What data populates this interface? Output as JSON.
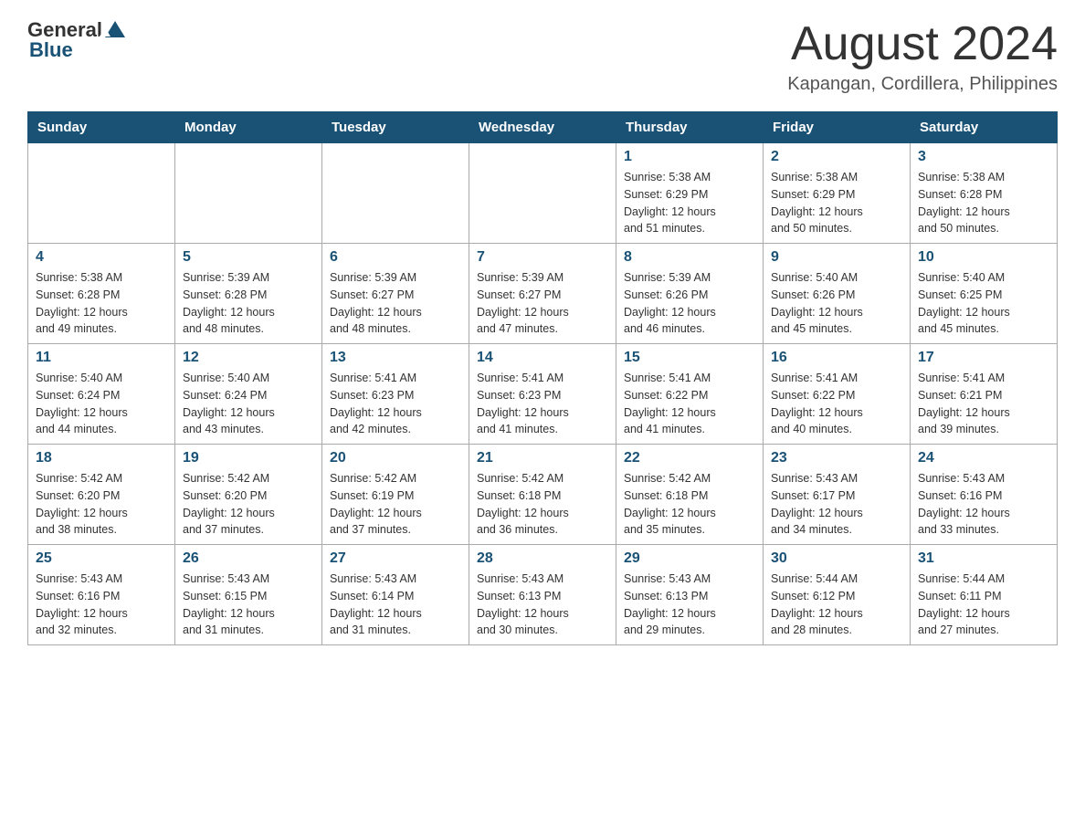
{
  "header": {
    "logo_general": "General",
    "logo_blue": "Blue",
    "title": "August 2024",
    "location": "Kapangan, Cordillera, Philippines"
  },
  "calendar": {
    "days_of_week": [
      "Sunday",
      "Monday",
      "Tuesday",
      "Wednesday",
      "Thursday",
      "Friday",
      "Saturday"
    ],
    "weeks": [
      [
        {
          "day": "",
          "info": ""
        },
        {
          "day": "",
          "info": ""
        },
        {
          "day": "",
          "info": ""
        },
        {
          "day": "",
          "info": ""
        },
        {
          "day": "1",
          "info": "Sunrise: 5:38 AM\nSunset: 6:29 PM\nDaylight: 12 hours\nand 51 minutes."
        },
        {
          "day": "2",
          "info": "Sunrise: 5:38 AM\nSunset: 6:29 PM\nDaylight: 12 hours\nand 50 minutes."
        },
        {
          "day": "3",
          "info": "Sunrise: 5:38 AM\nSunset: 6:28 PM\nDaylight: 12 hours\nand 50 minutes."
        }
      ],
      [
        {
          "day": "4",
          "info": "Sunrise: 5:38 AM\nSunset: 6:28 PM\nDaylight: 12 hours\nand 49 minutes."
        },
        {
          "day": "5",
          "info": "Sunrise: 5:39 AM\nSunset: 6:28 PM\nDaylight: 12 hours\nand 48 minutes."
        },
        {
          "day": "6",
          "info": "Sunrise: 5:39 AM\nSunset: 6:27 PM\nDaylight: 12 hours\nand 48 minutes."
        },
        {
          "day": "7",
          "info": "Sunrise: 5:39 AM\nSunset: 6:27 PM\nDaylight: 12 hours\nand 47 minutes."
        },
        {
          "day": "8",
          "info": "Sunrise: 5:39 AM\nSunset: 6:26 PM\nDaylight: 12 hours\nand 46 minutes."
        },
        {
          "day": "9",
          "info": "Sunrise: 5:40 AM\nSunset: 6:26 PM\nDaylight: 12 hours\nand 45 minutes."
        },
        {
          "day": "10",
          "info": "Sunrise: 5:40 AM\nSunset: 6:25 PM\nDaylight: 12 hours\nand 45 minutes."
        }
      ],
      [
        {
          "day": "11",
          "info": "Sunrise: 5:40 AM\nSunset: 6:24 PM\nDaylight: 12 hours\nand 44 minutes."
        },
        {
          "day": "12",
          "info": "Sunrise: 5:40 AM\nSunset: 6:24 PM\nDaylight: 12 hours\nand 43 minutes."
        },
        {
          "day": "13",
          "info": "Sunrise: 5:41 AM\nSunset: 6:23 PM\nDaylight: 12 hours\nand 42 minutes."
        },
        {
          "day": "14",
          "info": "Sunrise: 5:41 AM\nSunset: 6:23 PM\nDaylight: 12 hours\nand 41 minutes."
        },
        {
          "day": "15",
          "info": "Sunrise: 5:41 AM\nSunset: 6:22 PM\nDaylight: 12 hours\nand 41 minutes."
        },
        {
          "day": "16",
          "info": "Sunrise: 5:41 AM\nSunset: 6:22 PM\nDaylight: 12 hours\nand 40 minutes."
        },
        {
          "day": "17",
          "info": "Sunrise: 5:41 AM\nSunset: 6:21 PM\nDaylight: 12 hours\nand 39 minutes."
        }
      ],
      [
        {
          "day": "18",
          "info": "Sunrise: 5:42 AM\nSunset: 6:20 PM\nDaylight: 12 hours\nand 38 minutes."
        },
        {
          "day": "19",
          "info": "Sunrise: 5:42 AM\nSunset: 6:20 PM\nDaylight: 12 hours\nand 37 minutes."
        },
        {
          "day": "20",
          "info": "Sunrise: 5:42 AM\nSunset: 6:19 PM\nDaylight: 12 hours\nand 37 minutes."
        },
        {
          "day": "21",
          "info": "Sunrise: 5:42 AM\nSunset: 6:18 PM\nDaylight: 12 hours\nand 36 minutes."
        },
        {
          "day": "22",
          "info": "Sunrise: 5:42 AM\nSunset: 6:18 PM\nDaylight: 12 hours\nand 35 minutes."
        },
        {
          "day": "23",
          "info": "Sunrise: 5:43 AM\nSunset: 6:17 PM\nDaylight: 12 hours\nand 34 minutes."
        },
        {
          "day": "24",
          "info": "Sunrise: 5:43 AM\nSunset: 6:16 PM\nDaylight: 12 hours\nand 33 minutes."
        }
      ],
      [
        {
          "day": "25",
          "info": "Sunrise: 5:43 AM\nSunset: 6:16 PM\nDaylight: 12 hours\nand 32 minutes."
        },
        {
          "day": "26",
          "info": "Sunrise: 5:43 AM\nSunset: 6:15 PM\nDaylight: 12 hours\nand 31 minutes."
        },
        {
          "day": "27",
          "info": "Sunrise: 5:43 AM\nSunset: 6:14 PM\nDaylight: 12 hours\nand 31 minutes."
        },
        {
          "day": "28",
          "info": "Sunrise: 5:43 AM\nSunset: 6:13 PM\nDaylight: 12 hours\nand 30 minutes."
        },
        {
          "day": "29",
          "info": "Sunrise: 5:43 AM\nSunset: 6:13 PM\nDaylight: 12 hours\nand 29 minutes."
        },
        {
          "day": "30",
          "info": "Sunrise: 5:44 AM\nSunset: 6:12 PM\nDaylight: 12 hours\nand 28 minutes."
        },
        {
          "day": "31",
          "info": "Sunrise: 5:44 AM\nSunset: 6:11 PM\nDaylight: 12 hours\nand 27 minutes."
        }
      ]
    ]
  }
}
